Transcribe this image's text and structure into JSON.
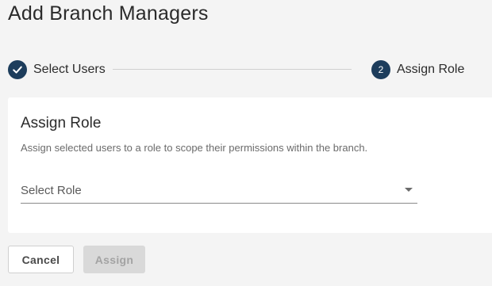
{
  "page": {
    "title": "Add Branch Managers"
  },
  "stepper": {
    "steps": [
      {
        "label": "Select Users",
        "status": "completed",
        "icon": "check-icon"
      },
      {
        "label": "Assign Role",
        "status": "current",
        "number": "2"
      }
    ]
  },
  "card": {
    "title": "Assign Role",
    "description": "Assign selected users to a role to scope their permissions within the branch.",
    "select": {
      "label": "Select Role",
      "icon": "chevron-down-icon"
    }
  },
  "actions": {
    "cancel_label": "Cancel",
    "assign_label": "Assign",
    "assign_disabled": true
  },
  "colors": {
    "accent": "#1d3d5c",
    "background": "#f4f4f4",
    "card": "#ffffff",
    "disabled_button": "#d9d9d9"
  }
}
